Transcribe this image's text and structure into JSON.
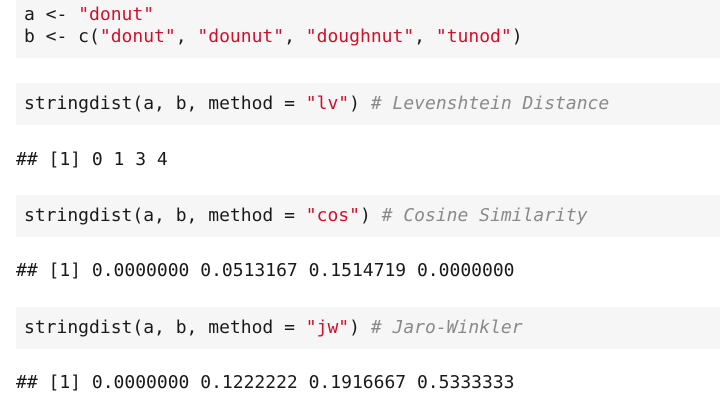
{
  "setup": {
    "line1": {
      "prefix": "a <- ",
      "value": "\"donut\""
    },
    "line2": {
      "prefix": "b <- c(",
      "items": [
        "\"donut\"",
        "\"dounut\"",
        "\"doughnut\"",
        "\"tunod\""
      ],
      "sep": ", ",
      "suffix": ")"
    }
  },
  "blocks": [
    {
      "call_prefix": "stringdist(a, b, method = ",
      "method": "\"lv\"",
      "call_suffix": ") ",
      "comment": "# Levenshtein Distance",
      "output": "## [1] 0 1 3 4"
    },
    {
      "call_prefix": "stringdist(a, b, method = ",
      "method": "\"cos\"",
      "call_suffix": ") ",
      "comment": "# Cosine Similarity",
      "output": "## [1] 0.0000000 0.0513167 0.1514719 0.0000000"
    },
    {
      "call_prefix": "stringdist(a, b, method = ",
      "method": "\"jw\"",
      "call_suffix": ") ",
      "comment": "# Jaro-Winkler",
      "output": "## [1] 0.0000000 0.1222222 0.1916667 0.5333333"
    }
  ],
  "colors": {
    "string": "#d0102a",
    "comment": "#8a8a8a",
    "code_background": "#f6f6f6"
  }
}
